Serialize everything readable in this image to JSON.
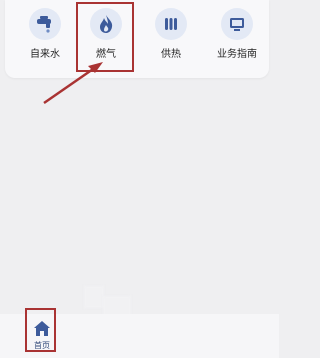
{
  "services": [
    {
      "label": "自来水",
      "icon": "faucet-icon"
    },
    {
      "label": "燃气",
      "icon": "flame-icon"
    },
    {
      "label": "供热",
      "icon": "radiator-icon"
    },
    {
      "label": "业务指南",
      "icon": "screen-icon"
    }
  ],
  "bottom_nav": {
    "home": {
      "label": "首页",
      "icon": "home-icon"
    }
  },
  "colors": {
    "accent": "#3d5b9b",
    "icon_bg": "#e3e9f5",
    "annotation_red": "#a93333"
  }
}
